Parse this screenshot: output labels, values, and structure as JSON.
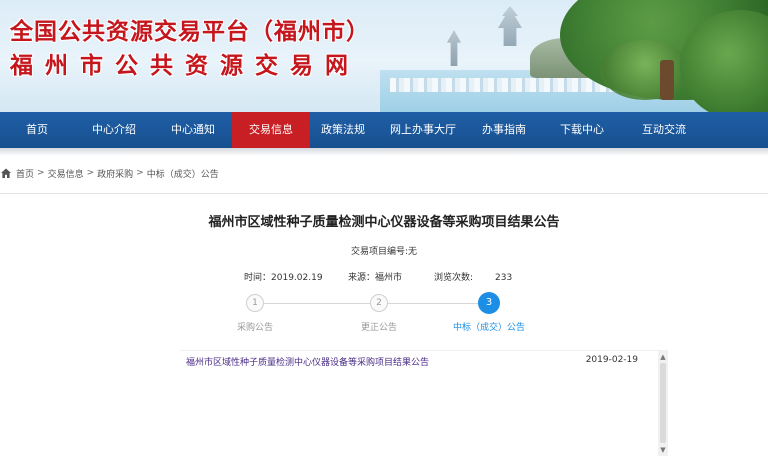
{
  "header": {
    "title_line1": "全国公共资源交易平台（福州市）",
    "title_line2": "福州市公共资源交易网"
  },
  "nav": {
    "items": [
      {
        "label": "首页"
      },
      {
        "label": "中心介绍"
      },
      {
        "label": "中心通知"
      },
      {
        "label": "交易信息"
      },
      {
        "label": "政策法规"
      },
      {
        "label": "网上办事大厅"
      },
      {
        "label": "办事指南"
      },
      {
        "label": "下载中心"
      },
      {
        "label": "互动交流"
      }
    ],
    "active": "交易信息",
    "active_color": "#c81f24",
    "bar_color": "#1f5ea6"
  },
  "breadcrumb": {
    "items": [
      "首页",
      "交易信息",
      "政府采购",
      "中标（成交）公告"
    ],
    "separator": ">"
  },
  "article": {
    "title": "福州市区域性种子质量检测中心仪器设备等采购项目结果公告",
    "trade_no": "交易项目编号:无",
    "time_label": "时间：",
    "time_value": "2019.02.19",
    "source_label": "来源：",
    "source_value": "福州市",
    "views_label": "浏览次数:",
    "views_value": "233"
  },
  "steps": [
    {
      "num": "1",
      "label": "采购公告",
      "active": false
    },
    {
      "num": "2",
      "label": "更正公告",
      "active": false
    },
    {
      "num": "3",
      "label": "中标（成交）公告",
      "active": true
    }
  ],
  "documents": [
    {
      "title": "福州市区域性种子质量检测中心仪器设备等采购项目结果公告",
      "date": "2019-02-19"
    }
  ],
  "icons": {
    "home": "home-icon",
    "scroll_up": "▲",
    "scroll_down": "▼"
  }
}
